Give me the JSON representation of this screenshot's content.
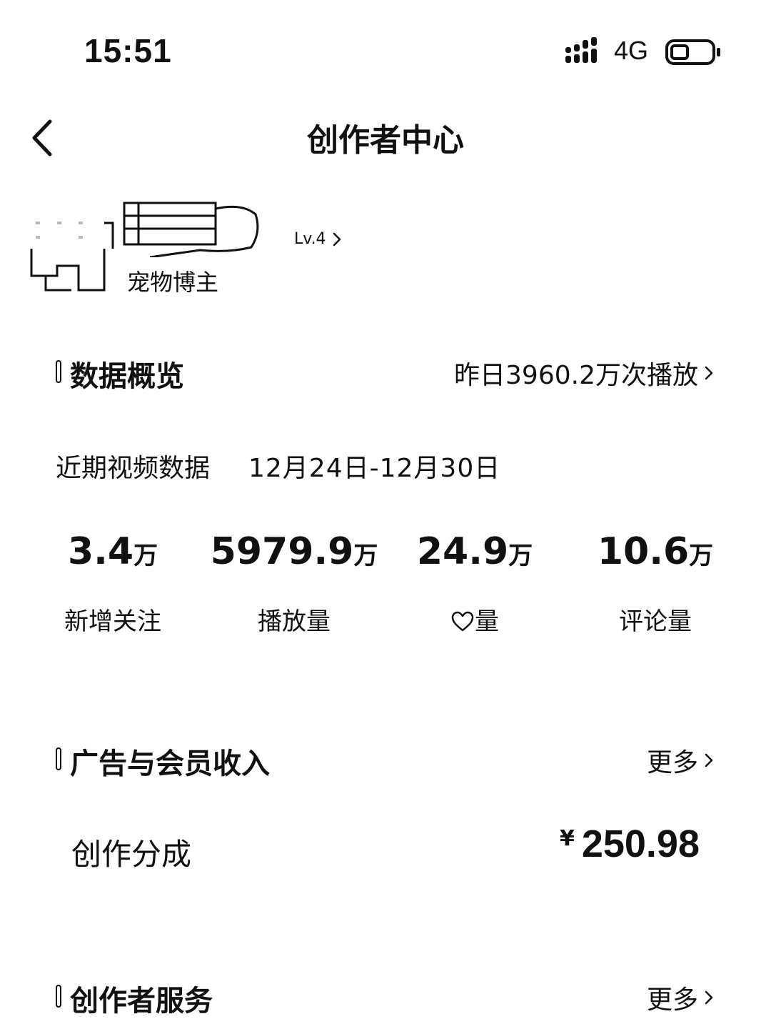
{
  "status_bar": {
    "time": "15:51",
    "network": "4G"
  },
  "nav": {
    "title": "创作者中心"
  },
  "profile": {
    "level": "Lv.4",
    "bio": "宠物博主"
  },
  "overview": {
    "title": "数据概览",
    "yesterday_plays": "昨日3960.2万次播放",
    "recent_label": "近期视频数据",
    "recent_range": "12月24日-12月30日",
    "metrics": [
      {
        "value": "3.4",
        "unit": "万",
        "label": "新增关注"
      },
      {
        "value": "5979.9",
        "unit": "万",
        "label": "播放量"
      },
      {
        "value": "24.9",
        "unit": "万",
        "label": "量"
      },
      {
        "value": "10.6",
        "unit": "万",
        "label": "评论量"
      }
    ]
  },
  "income": {
    "title": "广告与会员收入",
    "more": "更多",
    "item_label": "创作分成",
    "currency": "¥",
    "amount": "250.98"
  },
  "services": {
    "title": "创作者服务",
    "more": "更多"
  },
  "icons": {
    "back": "chevron-left-icon",
    "chevron": "chevron-right-icon",
    "like": "heart-icon",
    "signal": "signal-icon",
    "battery": "battery-icon"
  }
}
